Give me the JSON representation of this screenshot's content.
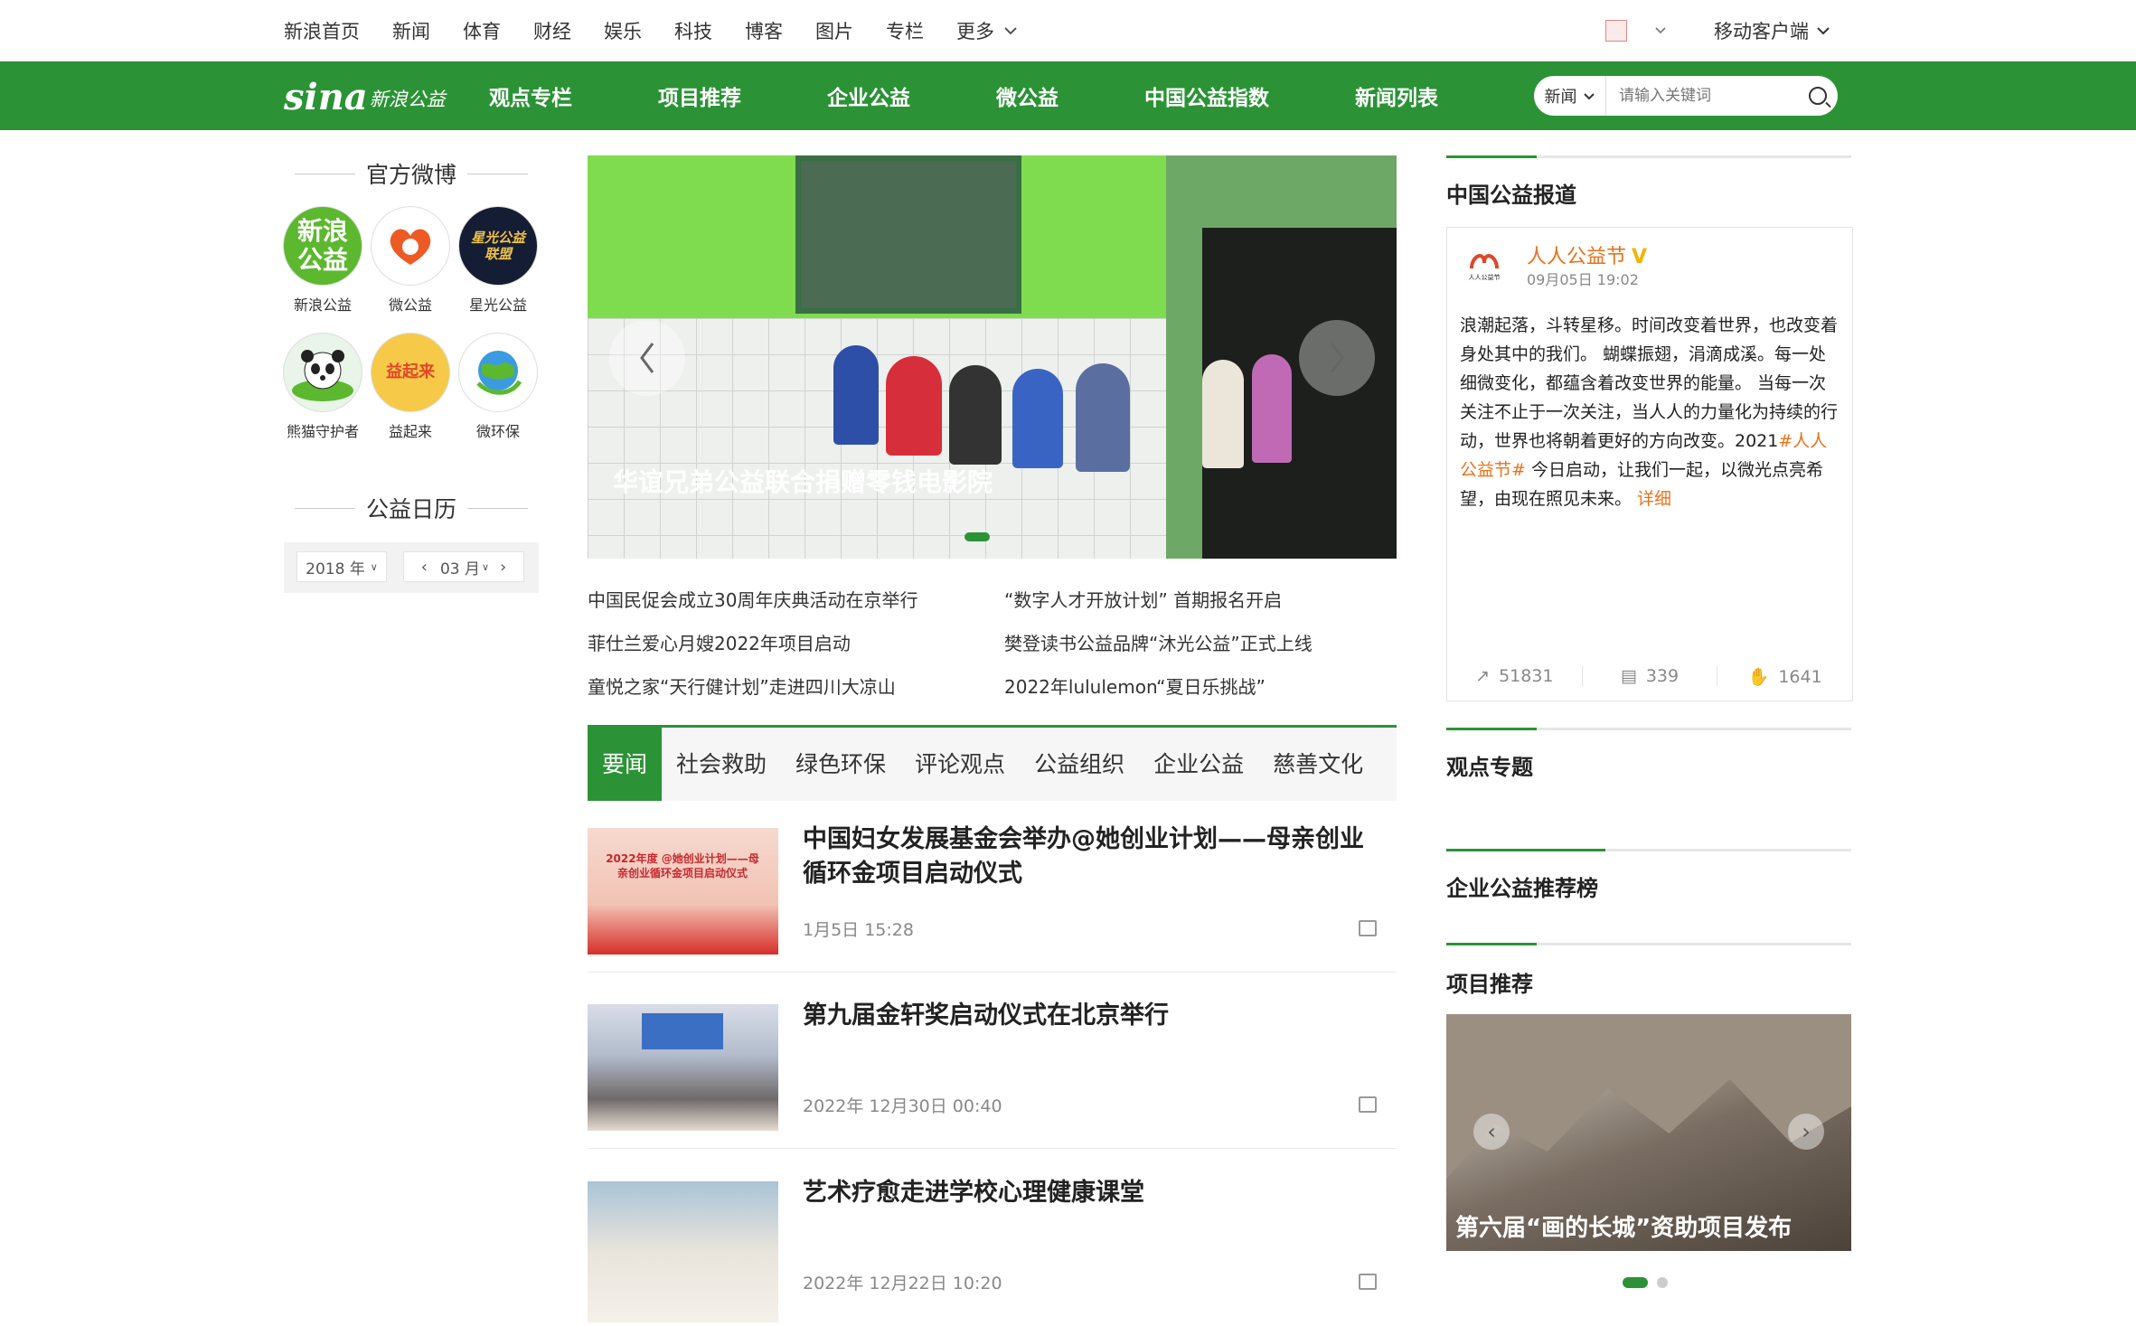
{
  "topnav": {
    "items": [
      "新浪首页",
      "新闻",
      "体育",
      "财经",
      "娱乐",
      "科技",
      "博客",
      "图片",
      "专栏"
    ],
    "more": "更多",
    "mobile": "移动客户端"
  },
  "header": {
    "logo_sina": "sina",
    "logo_text": "新浪公益",
    "nav": [
      "观点专栏",
      "项目推荐",
      "企业公益",
      "微公益",
      "中国公益指数",
      "新闻列表"
    ],
    "search": {
      "category": "新闻",
      "placeholder": "请输入关键词"
    }
  },
  "sidebar": {
    "weibo_title": "官方微博",
    "weibo": [
      {
        "label": "新浪公益",
        "logo_text": "新浪公益"
      },
      {
        "label": "微公益",
        "logo_text": ""
      },
      {
        "label": "星光公益",
        "logo_text": "星光公益联盟"
      },
      {
        "label": "熊猫守护者",
        "logo_text": ""
      },
      {
        "label": "益起来",
        "logo_text": "益起来"
      },
      {
        "label": "微环保",
        "logo_text": ""
      }
    ],
    "calendar_title": "公益日历",
    "calendar": {
      "year": "2018 年",
      "month": "03 月"
    }
  },
  "slider": {
    "caption": "华谊兄弟公益联合捐赠零钱电影院",
    "prev_icon": "chevron-left-icon",
    "next_icon": "chevron-right-icon"
  },
  "headlines": [
    "中国民促会成立30周年庆典活动在京举行",
    "“数字人才开放计划” 首期报名开启",
    "菲仕兰爱心月嫂2022年项目启动",
    "樊登读书公益品牌“沐光公益”正式上线",
    "童悦之家“天行健计划”走进四川大凉山",
    "2022年lululemon“夏日乐挑战”"
  ],
  "tabs": [
    "要闻",
    "社会救助",
    "绿色环保",
    "评论观点",
    "公益组织",
    "企业公益",
    "慈善文化"
  ],
  "articles": [
    {
      "title": "中国妇女发展基金会举办@她创业计划——母亲创业循环金项目启动仪式",
      "time": "1月5日 15:28",
      "thumb_text": "2022年度 @她创业计划——母亲创业循环金项目启动仪式"
    },
    {
      "title": "第九届金轩奖启动仪式在北京举行",
      "time": "2022年 12月30日 00:40",
      "thumb_text": ""
    },
    {
      "title": "艺术疗愈走进学校心理健康课堂",
      "time": "2022年 12月22日 10:20",
      "thumb_text": ""
    }
  ],
  "right": {
    "report_title": "中国公益报道",
    "weibo_card": {
      "avatar_text": "人人公益节",
      "name": "人人公益节",
      "verified": "V",
      "time": "09月05日 19:02",
      "body_pre": "浪潮起落，斗转星移。时间改变着世界，也改变着身处其中的我们。 蝴蝶振翅，涓滴成溪。每一处细微变化，都蕴含着改变世界的能量。 当每一次关注不止于一次关注，当人人的力量化为持续的行动，世界也将朝着更好的方向改变。2021",
      "hashtag": "#人人公益节#",
      "body_post": " 今日启动，让我们一起，以微光点亮希望，由现在照见未来。 ",
      "detail": "详细",
      "shares": "51831",
      "comments": "339",
      "likes": "1641"
    },
    "topic_title": "观点专题",
    "rank_title": "企业公益推荐榜",
    "project_title": "项目推荐",
    "project_caption": "第六届“画的长城”资助项目发布"
  },
  "colors": {
    "brand_green": "#2b9336",
    "accent_orange": "#e8721b"
  }
}
